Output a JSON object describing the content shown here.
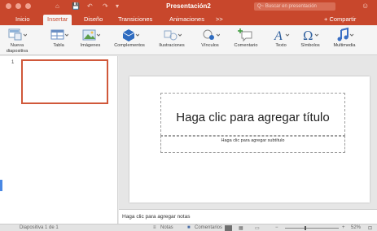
{
  "window": {
    "title": "Presentación2",
    "search_placeholder": "Q~ Buscar en presentación",
    "quick_access": [
      "⌂",
      "💾",
      "↶",
      "↷",
      "▾"
    ]
  },
  "colors": {
    "brand": "#c8472c",
    "ribbon_bg": "#f5f5f5",
    "selection_border": "#d0583a"
  },
  "tabs": [
    {
      "label": "Inicio",
      "active": false
    },
    {
      "label": "Insertar",
      "active": true
    },
    {
      "label": "Diseño",
      "active": false
    },
    {
      "label": "Transiciones",
      "active": false
    },
    {
      "label": "Animaciones",
      "active": false
    },
    {
      "label": ">>",
      "active": false
    }
  ],
  "share_label": "+ Compartir",
  "toolbar": [
    {
      "label_lines": [
        "Nueva",
        "diapositiva"
      ],
      "icon": "new-slide-icon"
    },
    {
      "label_lines": [
        "Tabla"
      ],
      "icon": "table-icon"
    },
    {
      "label_lines": [
        "Imágenes"
      ],
      "icon": "images-icon"
    },
    {
      "label_lines": [
        "Complementos"
      ],
      "icon": "addins-icon"
    },
    {
      "label_lines": [
        "Ilustraciones"
      ],
      "icon": "illustrations-icon"
    },
    {
      "label_lines": [
        "Vínculos"
      ],
      "icon": "links-icon"
    },
    {
      "label_lines": [
        "Comentario"
      ],
      "icon": "comment-icon"
    },
    {
      "label_lines": [
        "Texto"
      ],
      "icon": "text-icon"
    },
    {
      "label_lines": [
        "Símbolos"
      ],
      "icon": "symbols-icon"
    },
    {
      "label_lines": [
        "Multimedia"
      ],
      "icon": "multimedia-icon"
    }
  ],
  "thumbnails": [
    {
      "number": "1"
    }
  ],
  "slide": {
    "title_placeholder": "Haga clic para agregar título",
    "subtitle_placeholder": "Haga clic para agregar subtítulo"
  },
  "notes_placeholder": "Haga clic para agregar notas",
  "status": {
    "slide_info": "Diapositiva 1 de 1",
    "notes_label": "Notas",
    "comments_label": "Comentarios",
    "zoom": "52%",
    "zoom_minus": "−",
    "zoom_plus": "+"
  }
}
